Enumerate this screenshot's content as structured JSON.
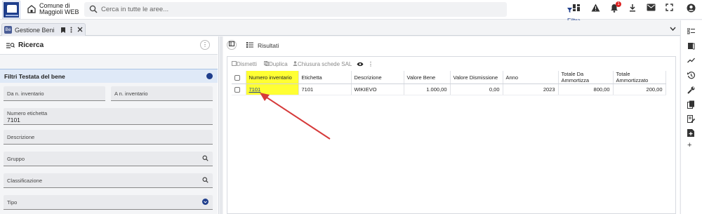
{
  "brand": {
    "line1": "Comune di",
    "line2": "Maggioli WEB"
  },
  "search": {
    "placeholder": "Cerca in tutte le aree...",
    "filter_label": "Filtra"
  },
  "notifications": {
    "count": "1"
  },
  "tab": {
    "app_icon": "Be",
    "label": "Gestione Beni"
  },
  "left": {
    "title": "Ricerca",
    "filters_header": "Filtri Testata del bene",
    "fields": {
      "da_n_inventario": "Da n. inventario",
      "a_n_inventario": "A n. inventario",
      "numero_etichetta_label": "Numero etichetta",
      "numero_etichetta_value": "7101",
      "descrizione": "Descrizione",
      "gruppo": "Gruppo",
      "classificazione": "Classificazione",
      "tipo": "Tipo"
    }
  },
  "right": {
    "title": "Risultati",
    "toolbar": {
      "dismetti": "Dismetti",
      "duplica": "Duplica",
      "chiusura": "Chiusura schede SAL"
    },
    "columns": [
      "Numero inventario",
      "Etichetta",
      "Descrizione",
      "Valore Bene",
      "Valore Dismissione",
      "Anno",
      "Totale Da Ammortizza",
      "Totale Ammortizzato"
    ],
    "rows": [
      [
        "7101",
        "7101",
        "WIKIEVO",
        "1.000,00",
        "0,00",
        "2023",
        "800,00",
        "200,00"
      ]
    ]
  },
  "colors": {
    "accent": "#1f3e8c",
    "highlight": "#ffff33",
    "arrow": "#d63a3a"
  }
}
